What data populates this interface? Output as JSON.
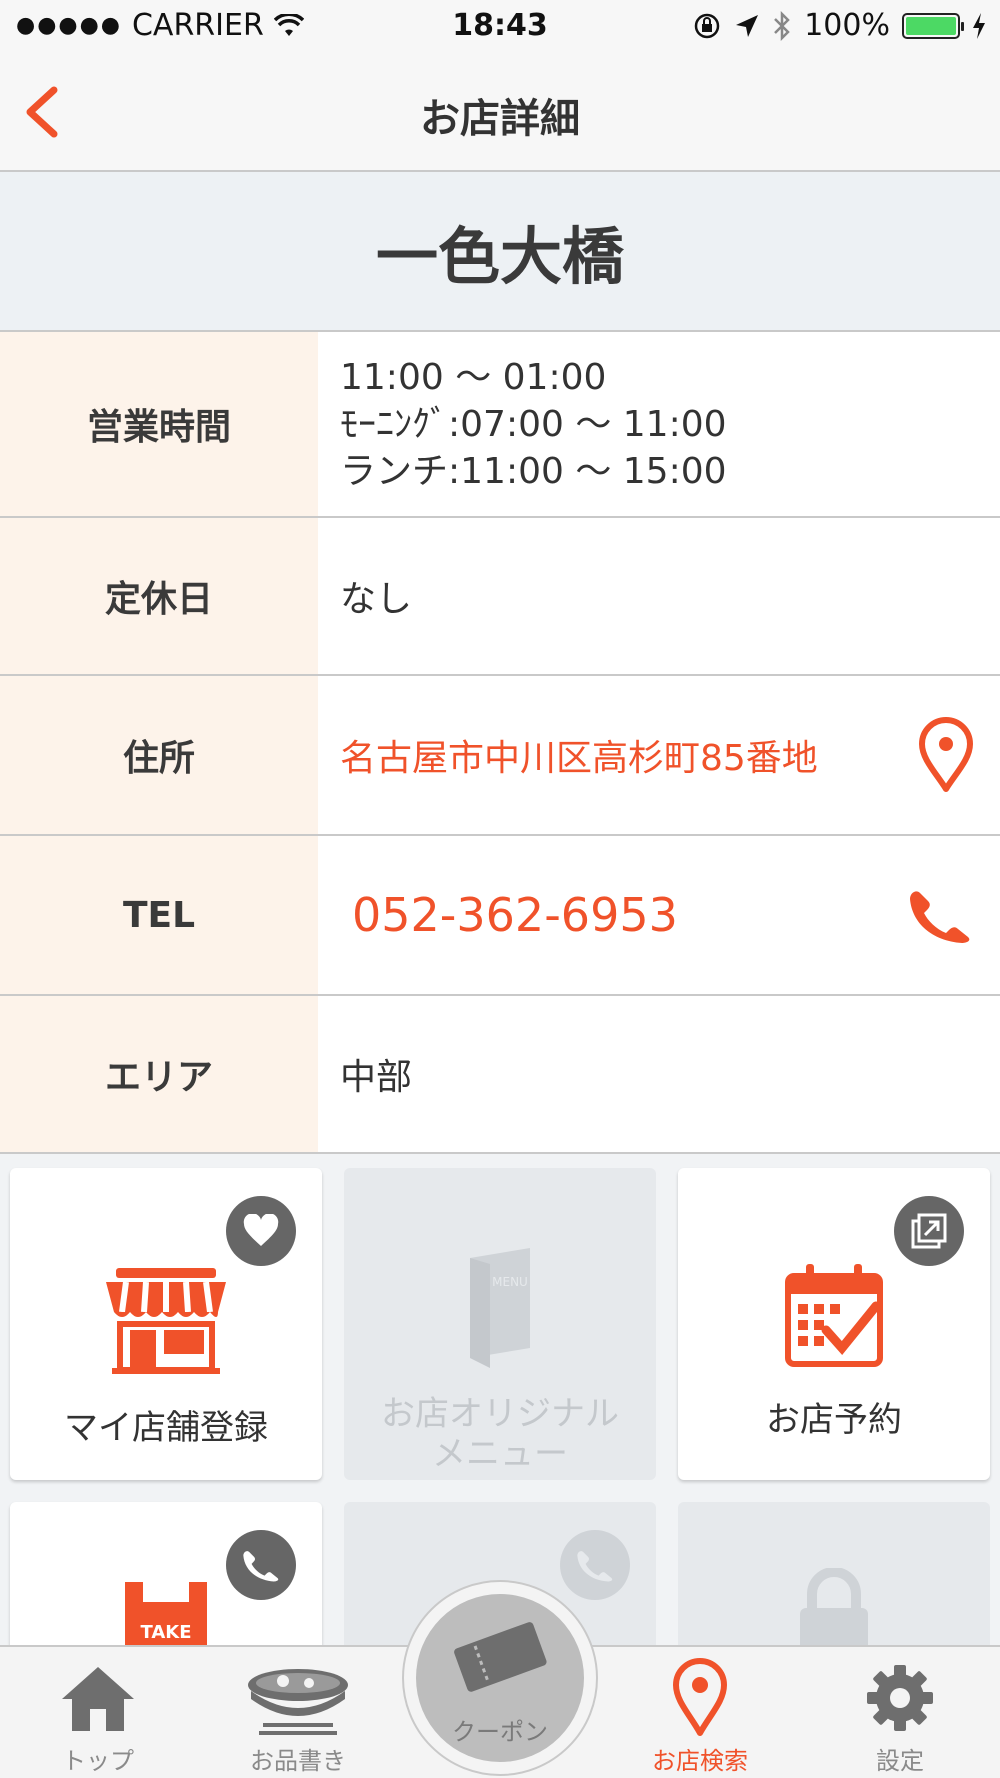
{
  "status_bar": {
    "carrier": "CARRIER",
    "time": "18:43",
    "battery": "100%"
  },
  "nav": {
    "title": "お店詳細"
  },
  "shop": {
    "name": "一色大橋"
  },
  "info": {
    "hours_label": "営業時間",
    "hours": [
      "11:00 〜 01:00",
      "ﾓｰﾆﾝｸﾞ:07:00 〜 11:00",
      "ランチ:11:00 〜 15:00"
    ],
    "closed_label": "定休日",
    "closed_value": "なし",
    "address_label": "住所",
    "address_value": "名古屋市中川区高杉町85番地",
    "tel_label": "TEL",
    "tel_value": "052-362-6953",
    "area_label": "エリア",
    "area_value": "中部"
  },
  "tiles": {
    "my_shop": "マイ店舗登録",
    "original_menu": "お店オリジナル\nメニュー",
    "menu_sign": "MENU",
    "reserve": "お店予約",
    "takeout_sign": "TAKE"
  },
  "tabs": {
    "top": "トップ",
    "menu": "お品書き",
    "coupon": "クーポン",
    "search": "お店検索",
    "settings": "設定"
  },
  "colors": {
    "accent": "#f0522a",
    "label_bg": "#fdf3ea",
    "header_bg": "#edf1f4"
  }
}
